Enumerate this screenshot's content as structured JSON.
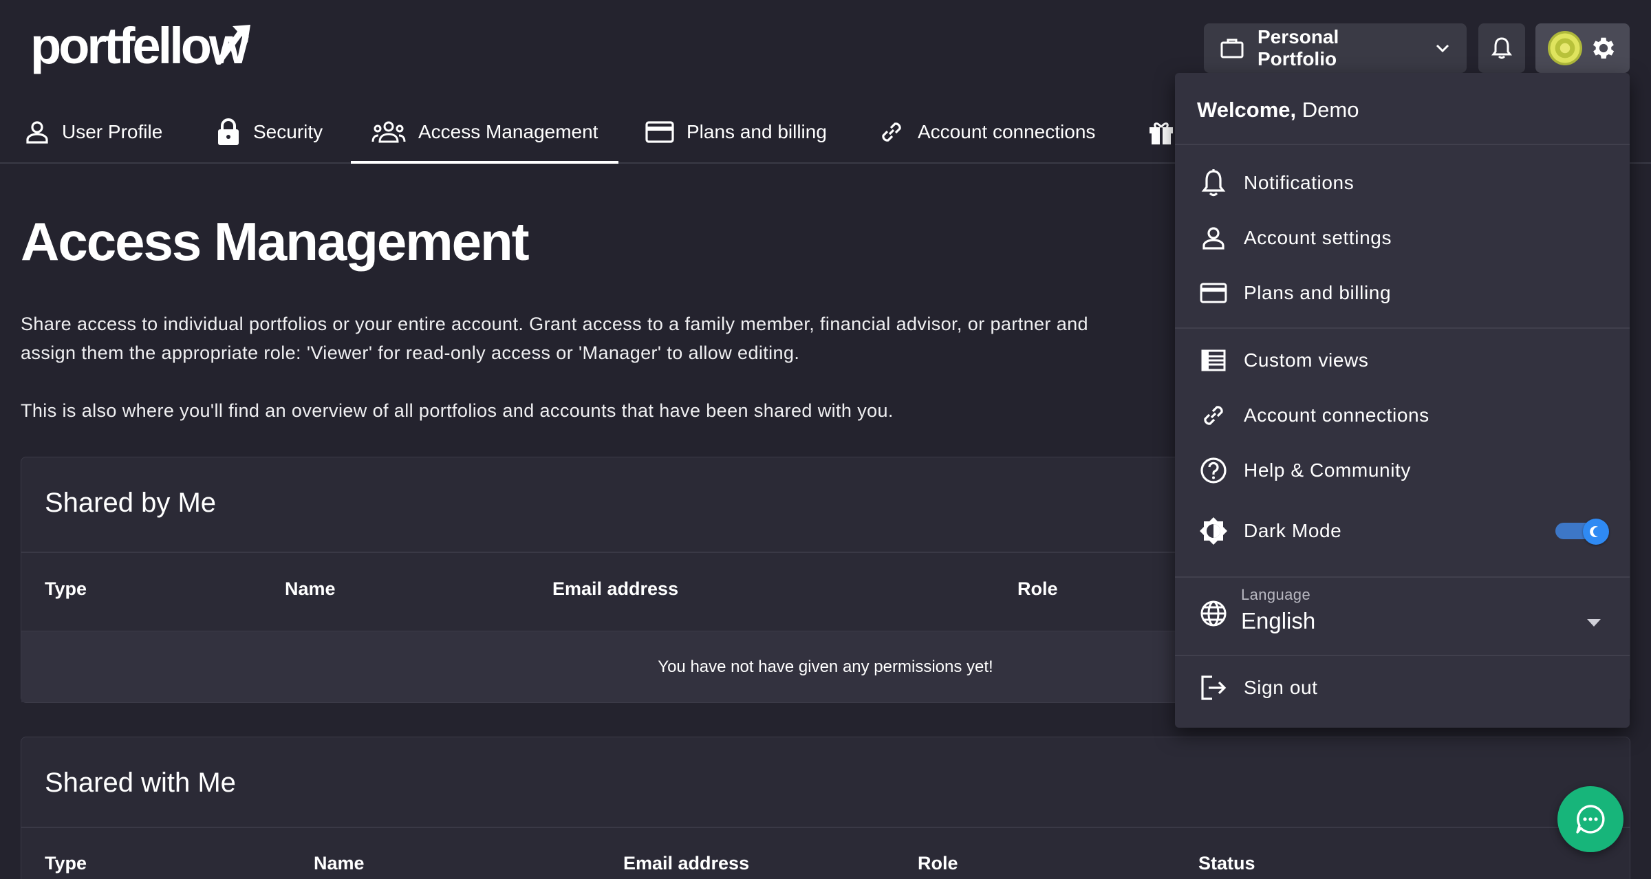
{
  "app": {
    "logo_text": "portfellow"
  },
  "header": {
    "portfolio_selector": "Personal Portfolio"
  },
  "tabs": [
    {
      "label": "User Profile"
    },
    {
      "label": "Security"
    },
    {
      "label": "Access Management",
      "active": true
    },
    {
      "label": "Plans and billing"
    },
    {
      "label": "Account connections"
    }
  ],
  "main": {
    "title": "Access Management",
    "description_1": "Share access to individual portfolios or your entire account. Grant access to a family member, financial advisor, or partner and assign them the appropriate role: 'Viewer' for read-only access or 'Manager' to allow editing.",
    "description_2": "This is also where you'll find an overview of all portfolios and accounts that have been shared with you.",
    "shared_by_me": {
      "title": "Shared by Me",
      "columns": [
        "Type",
        "Name",
        "Email address",
        "Role"
      ],
      "empty_message": "You have not have given any permissions yet!"
    },
    "shared_with_me": {
      "title": "Shared with Me",
      "columns": [
        "Type",
        "Name",
        "Email address",
        "Role",
        "Status"
      ]
    }
  },
  "menu": {
    "welcome_bold": "Welcome,",
    "welcome_name": "Demo",
    "items": [
      {
        "label": "Notifications",
        "icon": "bell-icon"
      },
      {
        "label": "Account settings",
        "icon": "person-icon"
      },
      {
        "label": "Plans and billing",
        "icon": "credit-card-icon"
      },
      {
        "label": "Custom views",
        "icon": "list-view-icon"
      },
      {
        "label": "Account connections",
        "icon": "link-icon"
      },
      {
        "label": "Help & Community",
        "icon": "help-icon"
      },
      {
        "label": "Dark Mode",
        "icon": "brightness-icon",
        "toggle_on": true
      }
    ],
    "language_label": "Language",
    "language_value": "English",
    "sign_out": "Sign out"
  },
  "colors": {
    "background": "#24232e",
    "card": "#2b2a36",
    "menu": "#33323f",
    "toggle_accent": "#2f8af3",
    "chat_button": "#17b57a"
  }
}
